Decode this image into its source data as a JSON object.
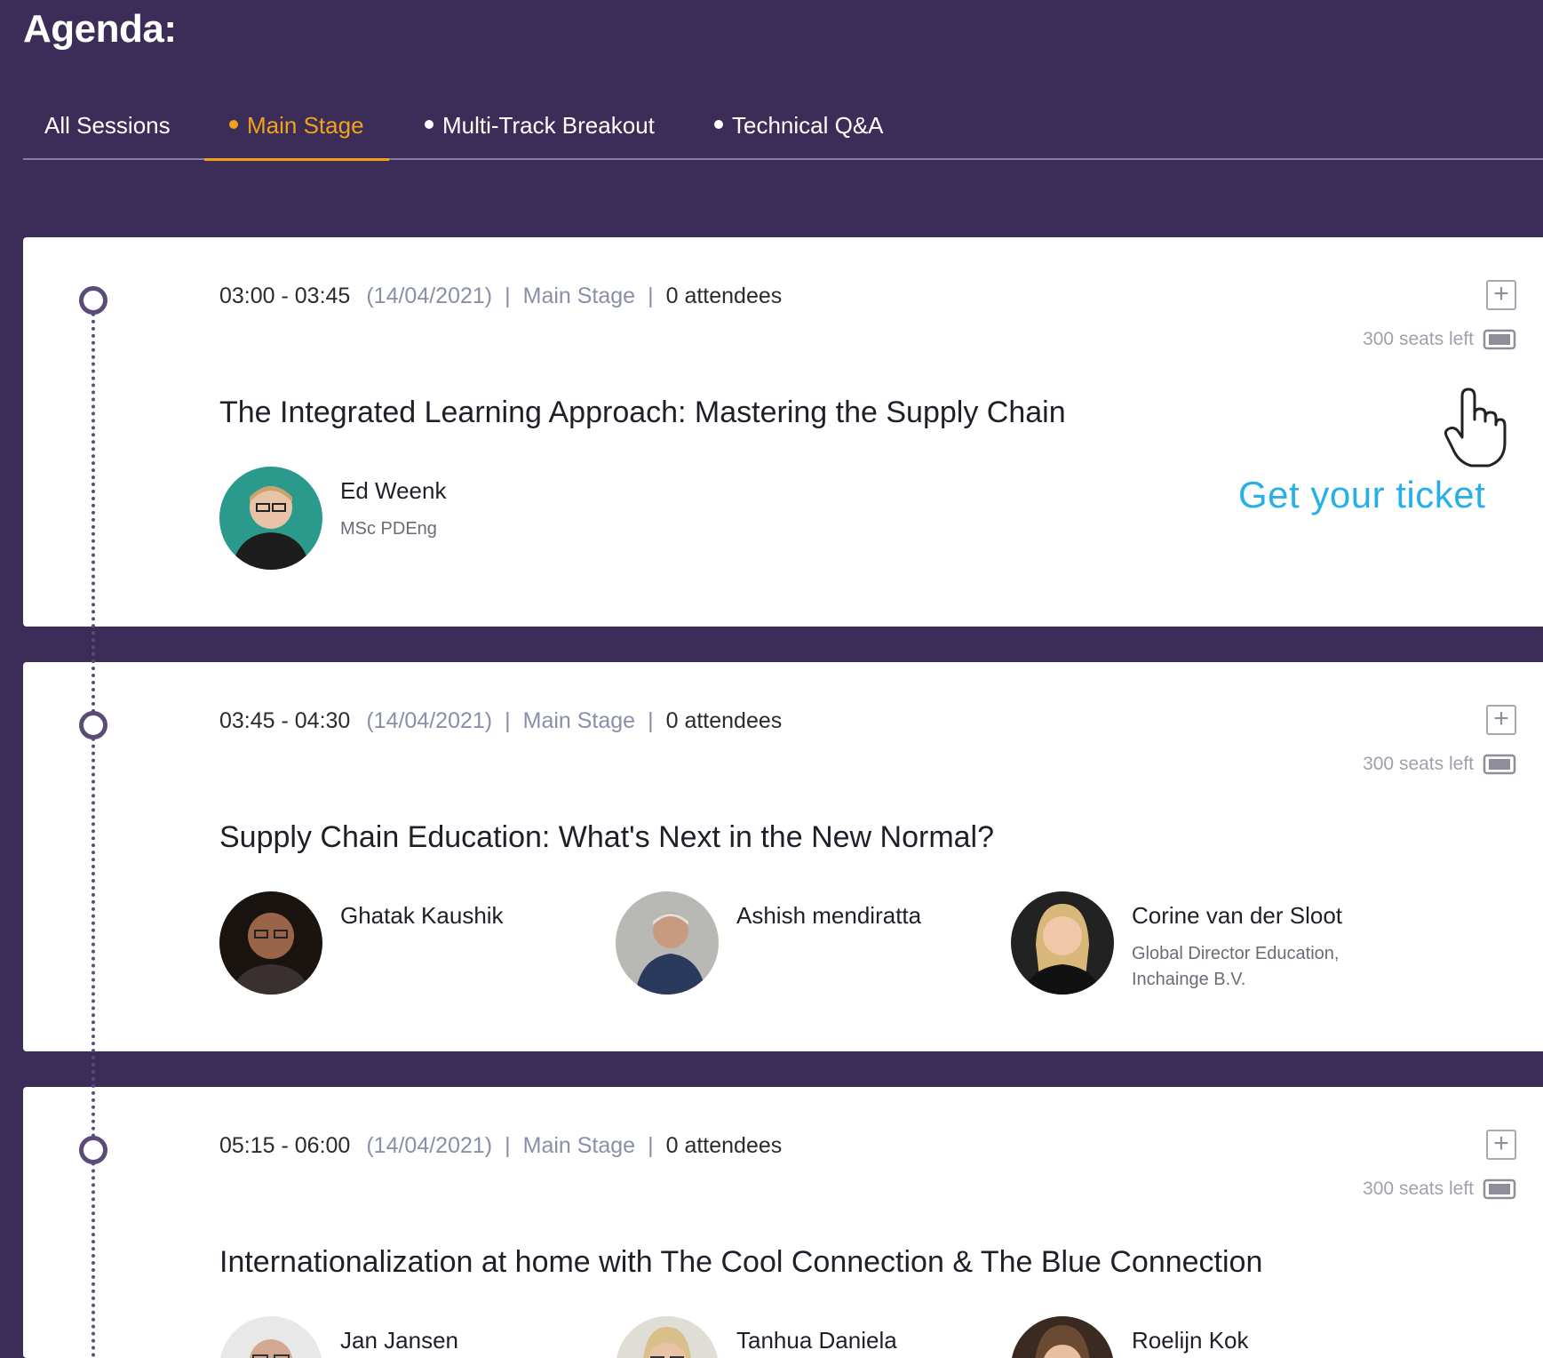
{
  "page": {
    "title": "Agenda:"
  },
  "tabs": [
    {
      "label": "All Sessions",
      "dot": false
    },
    {
      "label": "Main Stage",
      "dot": true
    },
    {
      "label": "Multi-Track Breakout",
      "dot": true
    },
    {
      "label": "Technical Q&A",
      "dot": true
    }
  ],
  "active_tab": "Main Stage",
  "colors": {
    "background": "#3b2d57",
    "accent": "#f0a31a",
    "cta": "#27b0e8",
    "card": "#ffffff"
  },
  "sessions": [
    {
      "time": "03:00 - 03:45",
      "date": "(14/04/2021)",
      "stage": "Main Stage",
      "attendees": "0 attendees",
      "seats": "300 seats left",
      "title": "The Integrated Learning Approach: Mastering the Supply Chain",
      "speakers": [
        {
          "name": "Ed Weenk",
          "role": "MSc PDEng"
        }
      ]
    },
    {
      "time": "03:45 - 04:30",
      "date": "(14/04/2021)",
      "stage": "Main Stage",
      "attendees": "0 attendees",
      "seats": "300 seats left",
      "title": "Supply Chain Education: What's Next in the New Normal?",
      "speakers": [
        {
          "name": "Ghatak Kaushik",
          "role": ""
        },
        {
          "name": "Ashish mendiratta",
          "role": ""
        },
        {
          "name": "Corine van der Sloot",
          "role": "Global Director Education, Inchainge B.V."
        }
      ]
    },
    {
      "time": "05:15 - 06:00",
      "date": "(14/04/2021)",
      "stage": "Main Stage",
      "attendees": "0 attendees",
      "seats": "300 seats left",
      "title": "Internationalization at home with The Cool Connection & The Blue Connection",
      "speakers": [
        {
          "name": "Jan Jansen",
          "role": ""
        },
        {
          "name": "Tanhua Daniela",
          "role": ""
        },
        {
          "name": "Roelijn Kok",
          "role": ""
        }
      ]
    }
  ],
  "cta": {
    "label": "Get your ticket"
  },
  "icons": {
    "add": "plus-square-icon",
    "seats": "ticket-icon",
    "cursor": "hand-pointer-icon",
    "timeline": "timeline-node-icon"
  }
}
